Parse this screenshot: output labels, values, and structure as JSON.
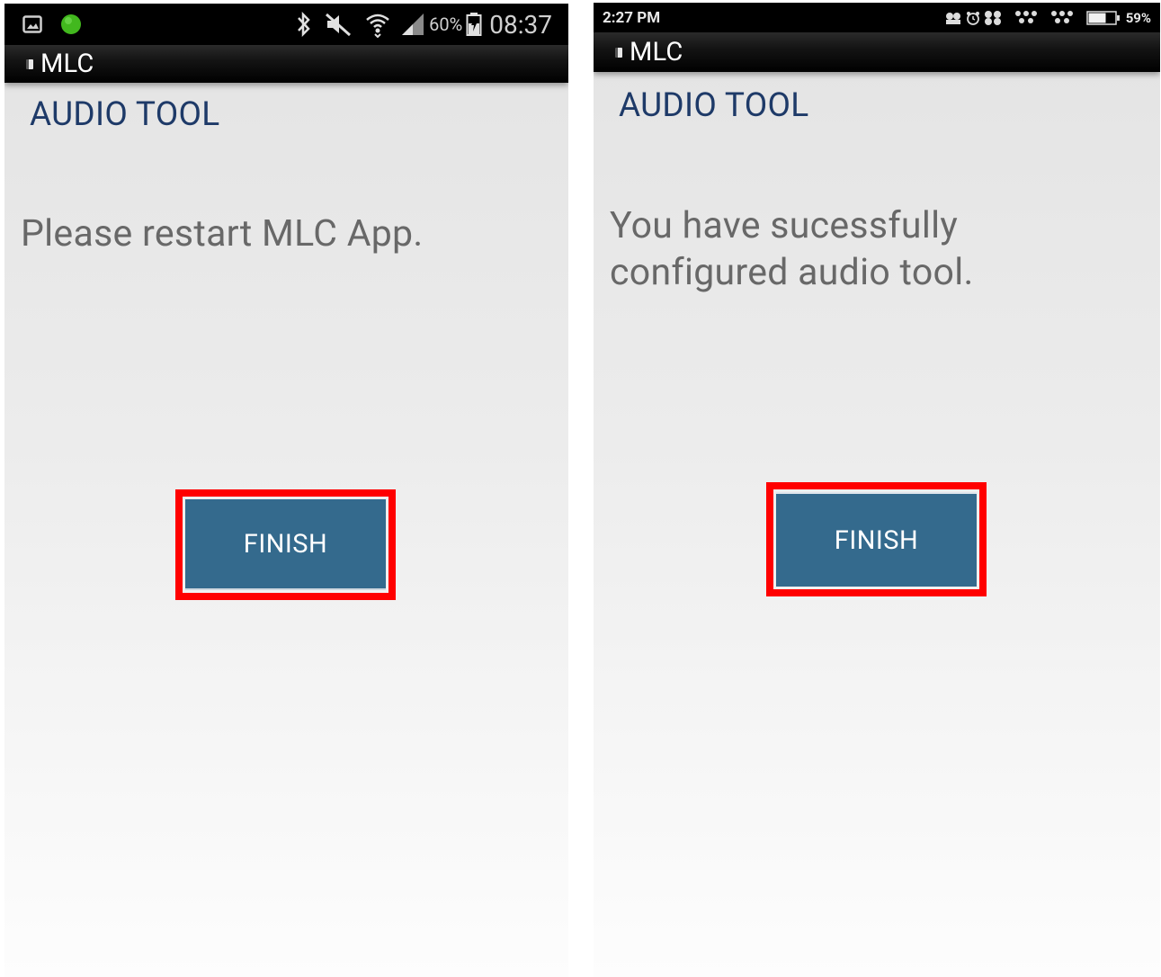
{
  "left": {
    "status_bar": {
      "battery": "60%",
      "time": "08:37",
      "icons": [
        "image-icon",
        "green-dot-icon",
        "bluetooth-icon",
        "mute-icon",
        "wifi-icon",
        "signal-icon",
        "battery-icon"
      ]
    },
    "app_bar": {
      "title": "MLC"
    },
    "screen": {
      "title": "AUDIO TOOL",
      "message": "Please restart MLC App.",
      "finish_label": "FINISH"
    }
  },
  "right": {
    "status_bar": {
      "time": "2:27 PM",
      "battery": "59%",
      "icons": [
        "notification-icon",
        "alarm-icon",
        "app-icon",
        "app-icon",
        "app-icon",
        "battery-icon"
      ]
    },
    "app_bar": {
      "title": "MLC"
    },
    "screen": {
      "title": "AUDIO TOOL",
      "message": "You have sucessfully\nconfigured audio tool.",
      "finish_label": "FINISH"
    }
  },
  "colors": {
    "highlight": "#ff0000",
    "button": "#346a8d",
    "title": "#1e3a68",
    "message": "#686868"
  }
}
